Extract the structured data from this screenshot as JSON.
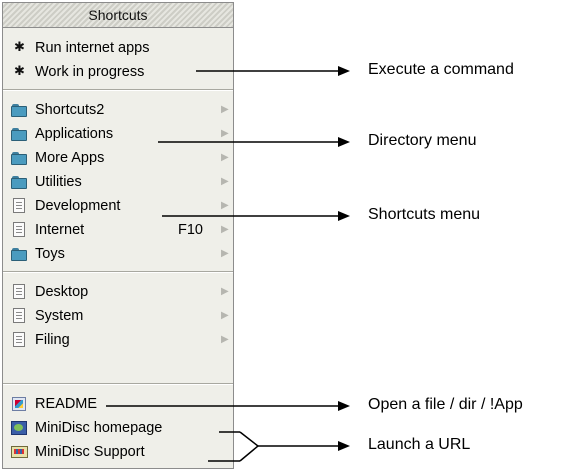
{
  "menu": {
    "title": "Shortcuts",
    "groups": [
      [
        {
          "label": "Run internet apps",
          "icon": "asterisk-icon"
        },
        {
          "label": "Work in progress",
          "icon": "asterisk-icon"
        }
      ],
      [
        {
          "label": "Shortcuts2",
          "icon": "folder-icon",
          "submenu": true
        },
        {
          "label": "Applications",
          "icon": "folder-icon",
          "submenu": true
        },
        {
          "label": "More Apps",
          "icon": "folder-icon",
          "submenu": true
        },
        {
          "label": "Utilities",
          "icon": "folder-icon",
          "submenu": true
        },
        {
          "label": "Development",
          "icon": "document-icon",
          "submenu": true
        },
        {
          "label": "Internet",
          "icon": "document-icon",
          "submenu": true,
          "shortcut": "F10"
        },
        {
          "label": "Toys",
          "icon": "folder-icon",
          "submenu": true
        }
      ],
      [
        {
          "label": "Desktop",
          "icon": "document-icon",
          "submenu": true
        },
        {
          "label": "System",
          "icon": "document-icon",
          "submenu": true
        },
        {
          "label": "Filing",
          "icon": "document-icon",
          "submenu": true
        }
      ],
      [
        {
          "label": "README",
          "icon": "readme-file-icon"
        },
        {
          "label": "MiniDisc homepage",
          "icon": "web-page-icon"
        },
        {
          "label": "MiniDisc Support",
          "icon": "web-link-icon"
        }
      ]
    ],
    "submenu_arrow": "▶"
  },
  "annotations": [
    "Execute a command",
    "Directory menu",
    "Shortcuts menu",
    "Open a file / dir / !App",
    "Launch a URL"
  ]
}
